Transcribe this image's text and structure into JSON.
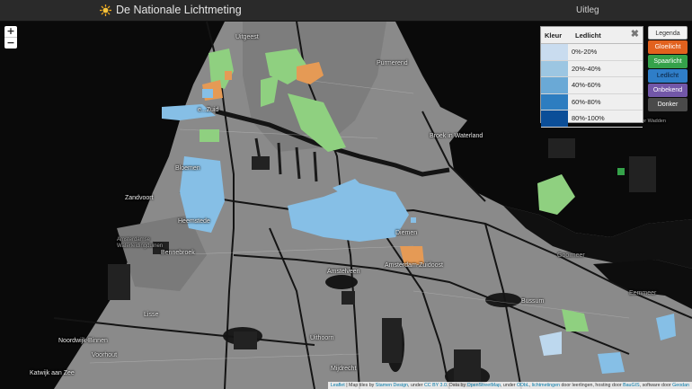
{
  "header": {
    "title": "De Nationale Lichtmeting",
    "nav_link": "Uitleg"
  },
  "zoom": {
    "in_label": "+",
    "out_label": "−"
  },
  "legend_table": {
    "col_color": "Kleur",
    "col_value": "Ledlicht",
    "close_label": "✖",
    "rows": [
      {
        "range": "0%-20%",
        "color": "#c9dcef"
      },
      {
        "range": "20%-40%",
        "color": "#9cc6e2"
      },
      {
        "range": "40%-60%",
        "color": "#6aa9d6"
      },
      {
        "range": "60%-80%",
        "color": "#2d7dc0"
      },
      {
        "range": "80%-100%",
        "color": "#0b4e98"
      }
    ]
  },
  "side_legend": {
    "items": [
      {
        "label": "Legenda",
        "bg": "#f2f2f2",
        "fg": "#333"
      },
      {
        "label": "Gloeilicht",
        "bg": "#e2611e",
        "fg": "#fff"
      },
      {
        "label": "Spaarlicht",
        "bg": "#35a24a",
        "fg": "#fff"
      },
      {
        "label": "Ledlicht",
        "bg": "#2f7ec8",
        "fg": "#0a1f3a"
      },
      {
        "label": "Onbekend",
        "bg": "#7257a8",
        "fg": "#fff"
      },
      {
        "label": "Donker",
        "bg": "#4a4a4a",
        "fg": "#fff"
      }
    ]
  },
  "map_labels": [
    "Uitgeest",
    "Purmerend",
    "Zaandam",
    "Broek in Waterland",
    "Bloemendaal",
    "Zandvoort",
    "Heemstede",
    "Amsterdamse Waterleidingduinen",
    "Bennebroek",
    "Diemen",
    "Amstelveen",
    "Amsterdam-Zuidoost",
    "Gooimeer",
    "Eemmeer",
    "Bussum",
    "Lisse",
    "Noordwijk-Binnen",
    "Voorhout",
    "Uithoorn",
    "Katwijk aan Zee",
    "Mijdrecht",
    "Marker Wadden"
  ],
  "attribution": {
    "leaflet": "Leaflet",
    "pre": " | Map tiles by ",
    "stamen": "Stamen Design",
    "mid1": ", under ",
    "ccby": "CC BY 3.0",
    "mid2": ". Data by ",
    "osm": "OpenStreetMap",
    "mid3": ", under ",
    "odbl": "ODbL",
    "sep": ", ",
    "lichtmetingen": "lichtmetingen",
    "mid4": " door leerlingen, hosting door ",
    "baugis": "BauGIS",
    "mid5": ", software door ",
    "geodan": "Geodan"
  }
}
